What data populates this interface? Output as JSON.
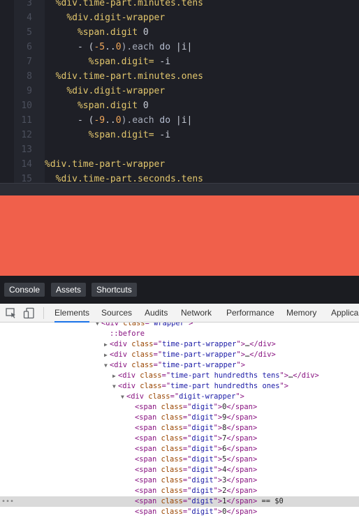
{
  "editor": {
    "lines": [
      {
        "num": "3",
        "indent": "  ",
        "parts": [
          {
            "t": "%div.time-part.minutes.tens",
            "c": "t-tag"
          }
        ]
      },
      {
        "num": "4",
        "indent": "    ",
        "parts": [
          {
            "t": "%div.digit-wrapper",
            "c": "t-tag"
          }
        ]
      },
      {
        "num": "5",
        "indent": "      ",
        "parts": [
          {
            "t": "%span.digit ",
            "c": "t-tag"
          },
          {
            "t": "0",
            "c": "t-var"
          }
        ]
      },
      {
        "num": "6",
        "indent": "      ",
        "parts": [
          {
            "t": "- (",
            "c": "t-var"
          },
          {
            "t": "-5",
            "c": "t-num"
          },
          {
            "t": "..",
            "c": "t-var"
          },
          {
            "t": "0",
            "c": "t-num"
          },
          {
            "t": ").each ",
            "c": "t-dim"
          },
          {
            "t": "do",
            "c": "t-kw"
          },
          {
            "t": " |i|",
            "c": "t-var"
          }
        ]
      },
      {
        "num": "7",
        "indent": "        ",
        "parts": [
          {
            "t": "%span.digit= ",
            "c": "t-tag"
          },
          {
            "t": "-i",
            "c": "t-var"
          }
        ]
      },
      {
        "num": "8",
        "indent": "  ",
        "parts": [
          {
            "t": "%div.time-part.minutes.ones",
            "c": "t-tag"
          }
        ]
      },
      {
        "num": "9",
        "indent": "    ",
        "parts": [
          {
            "t": "%div.digit-wrapper",
            "c": "t-tag"
          }
        ]
      },
      {
        "num": "10",
        "indent": "      ",
        "parts": [
          {
            "t": "%span.digit ",
            "c": "t-tag"
          },
          {
            "t": "0",
            "c": "t-var"
          }
        ]
      },
      {
        "num": "11",
        "indent": "      ",
        "parts": [
          {
            "t": "- (",
            "c": "t-var"
          },
          {
            "t": "-9",
            "c": "t-num"
          },
          {
            "t": "..",
            "c": "t-var"
          },
          {
            "t": "0",
            "c": "t-num"
          },
          {
            "t": ").each ",
            "c": "t-dim"
          },
          {
            "t": "do",
            "c": "t-kw"
          },
          {
            "t": " |i|",
            "c": "t-var"
          }
        ]
      },
      {
        "num": "12",
        "indent": "        ",
        "parts": [
          {
            "t": "%span.digit= ",
            "c": "t-tag"
          },
          {
            "t": "-i",
            "c": "t-var"
          }
        ]
      },
      {
        "num": "13",
        "indent": "",
        "parts": []
      },
      {
        "num": "14",
        "indent": "",
        "parts": [
          {
            "t": "%div.time-part-wrapper",
            "c": "t-tag"
          }
        ]
      },
      {
        "num": "15",
        "indent": "  ",
        "parts": [
          {
            "t": "%div.time-part.seconds.tens",
            "c": "t-tag"
          }
        ]
      }
    ]
  },
  "preview": {
    "color": "#f0604b"
  },
  "toolbar": {
    "console_label": "Console",
    "assets_label": "Assets",
    "shortcuts_label": "Shortcuts"
  },
  "devtools": {
    "tabs": [
      "Elements",
      "Sources",
      "Audits",
      "Network",
      "Performance",
      "Memory",
      "Applica"
    ],
    "active_tab": "Elements",
    "tree": [
      {
        "depth": 0,
        "arrow": "▼",
        "html": [
          [
            "tg",
            "<div "
          ],
          [
            "an",
            "class"
          ],
          [
            "tg",
            "=\""
          ],
          [
            "av",
            "wrapper"
          ],
          [
            "tg",
            "\">"
          ]
        ]
      },
      {
        "depth": 1,
        "arrow": "",
        "html": [
          [
            "ps",
            "::before"
          ]
        ]
      },
      {
        "depth": 1,
        "arrow": "▶",
        "html": [
          [
            "tg",
            "<div "
          ],
          [
            "an",
            "class"
          ],
          [
            "tg",
            "=\""
          ],
          [
            "av",
            "time-part-wrapper"
          ],
          [
            "tg",
            "\">"
          ],
          [
            "pl",
            "…"
          ],
          [
            "tg",
            "</div>"
          ]
        ]
      },
      {
        "depth": 1,
        "arrow": "▶",
        "html": [
          [
            "tg",
            "<div "
          ],
          [
            "an",
            "class"
          ],
          [
            "tg",
            "=\""
          ],
          [
            "av",
            "time-part-wrapper"
          ],
          [
            "tg",
            "\">"
          ],
          [
            "pl",
            "…"
          ],
          [
            "tg",
            "</div>"
          ]
        ]
      },
      {
        "depth": 1,
        "arrow": "▼",
        "html": [
          [
            "tg",
            "<div "
          ],
          [
            "an",
            "class"
          ],
          [
            "tg",
            "=\""
          ],
          [
            "av",
            "time-part-wrapper"
          ],
          [
            "tg",
            "\">"
          ]
        ]
      },
      {
        "depth": 2,
        "arrow": "▶",
        "html": [
          [
            "tg",
            "<div "
          ],
          [
            "an",
            "class"
          ],
          [
            "tg",
            "=\""
          ],
          [
            "av",
            "time-part hundredths tens"
          ],
          [
            "tg",
            "\">"
          ],
          [
            "pl",
            "…"
          ],
          [
            "tg",
            "</div>"
          ]
        ]
      },
      {
        "depth": 2,
        "arrow": "▼",
        "html": [
          [
            "tg",
            "<div "
          ],
          [
            "an",
            "class"
          ],
          [
            "tg",
            "=\""
          ],
          [
            "av",
            "time-part hundredths ones"
          ],
          [
            "tg",
            "\">"
          ]
        ]
      },
      {
        "depth": 3,
        "arrow": "▼",
        "html": [
          [
            "tg",
            "<div "
          ],
          [
            "an",
            "class"
          ],
          [
            "tg",
            "=\""
          ],
          [
            "av",
            "digit-wrapper"
          ],
          [
            "tg",
            "\">"
          ]
        ]
      },
      {
        "depth": 4,
        "arrow": "",
        "html": [
          [
            "tg",
            "<span "
          ],
          [
            "an",
            "class"
          ],
          [
            "tg",
            "=\""
          ],
          [
            "av",
            "digit"
          ],
          [
            "tg",
            "\">"
          ],
          [
            "pl",
            "0"
          ],
          [
            "tg",
            "</span>"
          ]
        ]
      },
      {
        "depth": 4,
        "arrow": "",
        "html": [
          [
            "tg",
            "<span "
          ],
          [
            "an",
            "class"
          ],
          [
            "tg",
            "=\""
          ],
          [
            "av",
            "digit"
          ],
          [
            "tg",
            "\">"
          ],
          [
            "pl",
            "9"
          ],
          [
            "tg",
            "</span>"
          ]
        ]
      },
      {
        "depth": 4,
        "arrow": "",
        "html": [
          [
            "tg",
            "<span "
          ],
          [
            "an",
            "class"
          ],
          [
            "tg",
            "=\""
          ],
          [
            "av",
            "digit"
          ],
          [
            "tg",
            "\">"
          ],
          [
            "pl",
            "8"
          ],
          [
            "tg",
            "</span>"
          ]
        ]
      },
      {
        "depth": 4,
        "arrow": "",
        "html": [
          [
            "tg",
            "<span "
          ],
          [
            "an",
            "class"
          ],
          [
            "tg",
            "=\""
          ],
          [
            "av",
            "digit"
          ],
          [
            "tg",
            "\">"
          ],
          [
            "pl",
            "7"
          ],
          [
            "tg",
            "</span>"
          ]
        ]
      },
      {
        "depth": 4,
        "arrow": "",
        "html": [
          [
            "tg",
            "<span "
          ],
          [
            "an",
            "class"
          ],
          [
            "tg",
            "=\""
          ],
          [
            "av",
            "digit"
          ],
          [
            "tg",
            "\">"
          ],
          [
            "pl",
            "6"
          ],
          [
            "tg",
            "</span>"
          ]
        ]
      },
      {
        "depth": 4,
        "arrow": "",
        "html": [
          [
            "tg",
            "<span "
          ],
          [
            "an",
            "class"
          ],
          [
            "tg",
            "=\""
          ],
          [
            "av",
            "digit"
          ],
          [
            "tg",
            "\">"
          ],
          [
            "pl",
            "5"
          ],
          [
            "tg",
            "</span>"
          ]
        ]
      },
      {
        "depth": 4,
        "arrow": "",
        "html": [
          [
            "tg",
            "<span "
          ],
          [
            "an",
            "class"
          ],
          [
            "tg",
            "=\""
          ],
          [
            "av",
            "digit"
          ],
          [
            "tg",
            "\">"
          ],
          [
            "pl",
            "4"
          ],
          [
            "tg",
            "</span>"
          ]
        ]
      },
      {
        "depth": 4,
        "arrow": "",
        "html": [
          [
            "tg",
            "<span "
          ],
          [
            "an",
            "class"
          ],
          [
            "tg",
            "=\""
          ],
          [
            "av",
            "digit"
          ],
          [
            "tg",
            "\">"
          ],
          [
            "pl",
            "3"
          ],
          [
            "tg",
            "</span>"
          ]
        ]
      },
      {
        "depth": 4,
        "arrow": "",
        "html": [
          [
            "tg",
            "<span "
          ],
          [
            "an",
            "class"
          ],
          [
            "tg",
            "=\""
          ],
          [
            "av",
            "digit"
          ],
          [
            "tg",
            "\">"
          ],
          [
            "pl",
            "2"
          ],
          [
            "tg",
            "</span>"
          ]
        ]
      },
      {
        "depth": 4,
        "arrow": "",
        "selected": true,
        "html": [
          [
            "tg",
            "<span "
          ],
          [
            "an",
            "class"
          ],
          [
            "tg",
            "=\""
          ],
          [
            "av",
            "digit"
          ],
          [
            "tg",
            "\">"
          ],
          [
            "pl",
            "1"
          ],
          [
            "tg",
            "</span>"
          ],
          [
            "pl",
            " == $0"
          ]
        ]
      },
      {
        "depth": 4,
        "arrow": "",
        "html": [
          [
            "tg",
            "<span "
          ],
          [
            "an",
            "class"
          ],
          [
            "tg",
            "=\""
          ],
          [
            "av",
            "digit"
          ],
          [
            "tg",
            "\">"
          ],
          [
            "pl",
            "0"
          ],
          [
            "tg",
            "</span>"
          ]
        ]
      }
    ],
    "selected_marker": "•••"
  }
}
